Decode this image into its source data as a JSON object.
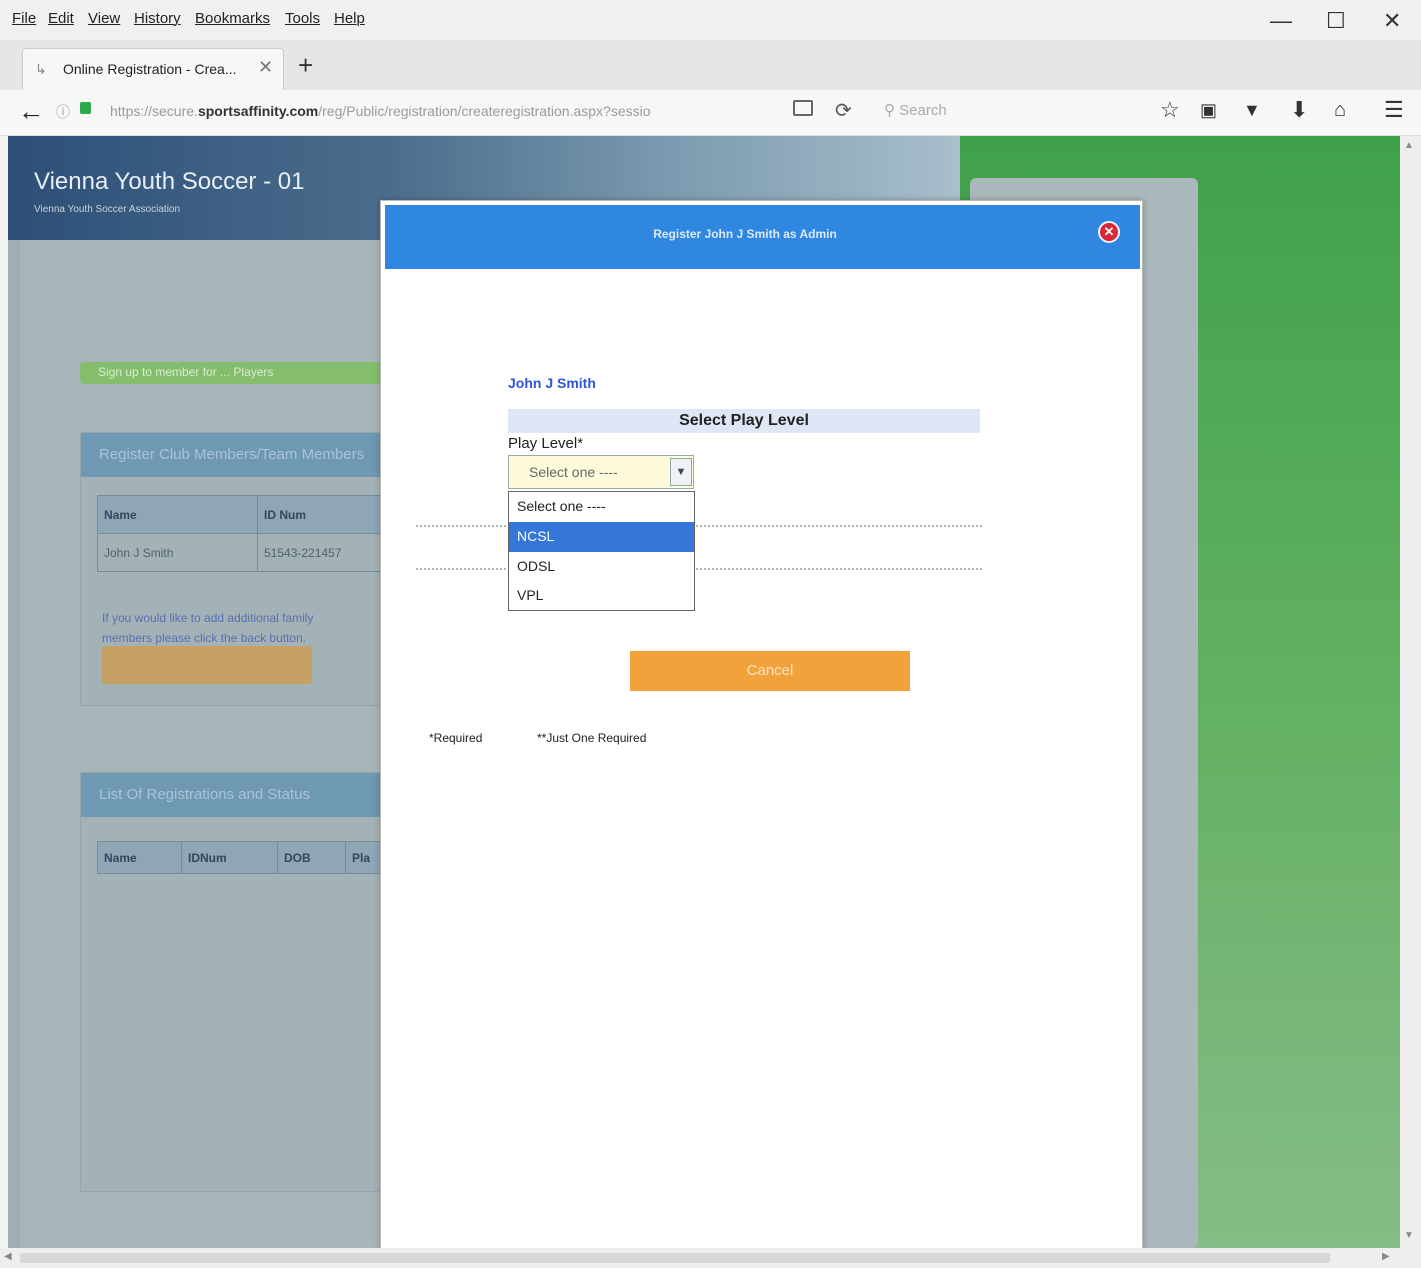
{
  "menu": [
    "File",
    "Edit",
    "View",
    "History",
    "Bookmarks",
    "Tools",
    "Help"
  ],
  "window_controls": {
    "minimize": "—",
    "maximize": "☐",
    "close": "✕"
  },
  "tab": {
    "title": "Online Registration - Crea...",
    "close": "✕",
    "new_tab": "+"
  },
  "nav": {
    "url_prefix": "https://secure.",
    "url_domain": "sportsaffinity.com",
    "url_path": "/reg/Public/registration/createregistration.aspx?sessio",
    "search_placeholder": "Search"
  },
  "site": {
    "title": "Vienna Youth Soccer - 01",
    "subtitle": "Vienna Youth Soccer Association"
  },
  "background": {
    "green_bar": "Sign up to member for ... Players",
    "section1_title": "Register Club Members/Team Members",
    "table1_headers": [
      "Name",
      "ID Num"
    ],
    "table1_row": [
      "John J Smith",
      "51543-221457"
    ],
    "link_text_1": "If you would like to add additional family",
    "link_text_2": "members please click the back button.",
    "section2_title": "List Of Registrations and Status",
    "table2_headers": [
      "Name",
      "IDNum",
      "DOB",
      "Pla"
    ]
  },
  "modal": {
    "title": "Register John J Smith as Admin",
    "close_symbol": "✕",
    "player_name": "John J Smith",
    "section_heading": "Select Play Level",
    "field_label": "Play Level*",
    "select_value": "Select one ----",
    "options": [
      "Select one ----",
      "NCSL",
      "ODSL",
      "VPL"
    ],
    "selected_index": 1,
    "cancel_label": "Cancel",
    "note_required": "*Required",
    "note_just_one": "**Just One Required"
  }
}
